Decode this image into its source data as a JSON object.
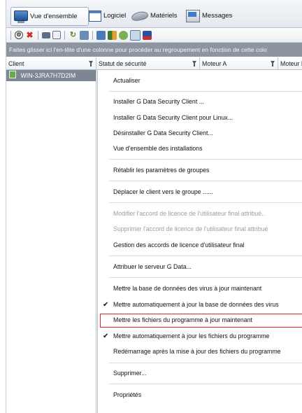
{
  "tabs": [
    {
      "label": "Vue d'ensemble",
      "icon": "monitor-icon",
      "active": true
    },
    {
      "label": "Logiciel",
      "icon": "window-icon"
    },
    {
      "label": "Matériels",
      "icon": "hardware-icon"
    },
    {
      "label": "Messages",
      "icon": "messages-icon"
    }
  ],
  "toolbar": {
    "icons": [
      "settings-icon",
      "delete-icon",
      "print-icon",
      "preview-icon",
      "refresh-icon",
      "filter-icon",
      "install-icon",
      "chart-icon",
      "network-icon",
      "report-icon",
      "flag-icon"
    ]
  },
  "groupbar": {
    "text": "Faites glisser ici l'en-tête d'une colonne pour procéder au regroupement en fonction de cette colo"
  },
  "columns": [
    "Client",
    "Statut de sécurité",
    "Moteur A",
    "Moteur B"
  ],
  "rows": [
    {
      "client": "WIN-3JRA7H7D2IM"
    }
  ],
  "context_menu": {
    "items": [
      {
        "label": "Actualiser"
      },
      {
        "label": "Installer G Data Security Client ..."
      },
      {
        "label": "Installer G Data Security Client pour Linux..."
      },
      {
        "label": "Désinstaller G Data Security Client..."
      },
      {
        "label": "Vue d'ensemble des installations"
      },
      {
        "label": "Rétablir les paramètres de groupes"
      },
      {
        "label": "Déplacer le client vers le groupe ......"
      },
      {
        "label": "Modifier l'accord de licence de l'utilisateur final attribué..",
        "disabled": true
      },
      {
        "label": "Supprimer l'accord de licence de l'utilisateur final attribué",
        "disabled": true
      },
      {
        "label": "Gestion des accords de licence d'utilisateur final"
      },
      {
        "label": "Attribuer le serveur G Data..."
      },
      {
        "label": "Mettre la base de données des virus à jour maintenant"
      },
      {
        "label": "Mettre automatiquement à jour la base de données des virus",
        "checked": true
      },
      {
        "label": "Mettre les fichiers du programme à jour maintenant",
        "highlighted": true
      },
      {
        "label": "Mettre automatiquement à jour les fichiers du programme",
        "checked": true
      },
      {
        "label": "Redémarrage après la mise à jour des fichiers du programme"
      },
      {
        "label": "Supprimer..."
      },
      {
        "label": "Propriétés"
      }
    ],
    "check_glyph": "✔",
    "highlight_color": "#e0262b"
  },
  "colors": {
    "group_bar": "#8d95a1",
    "selected_row": "#7d8694"
  }
}
